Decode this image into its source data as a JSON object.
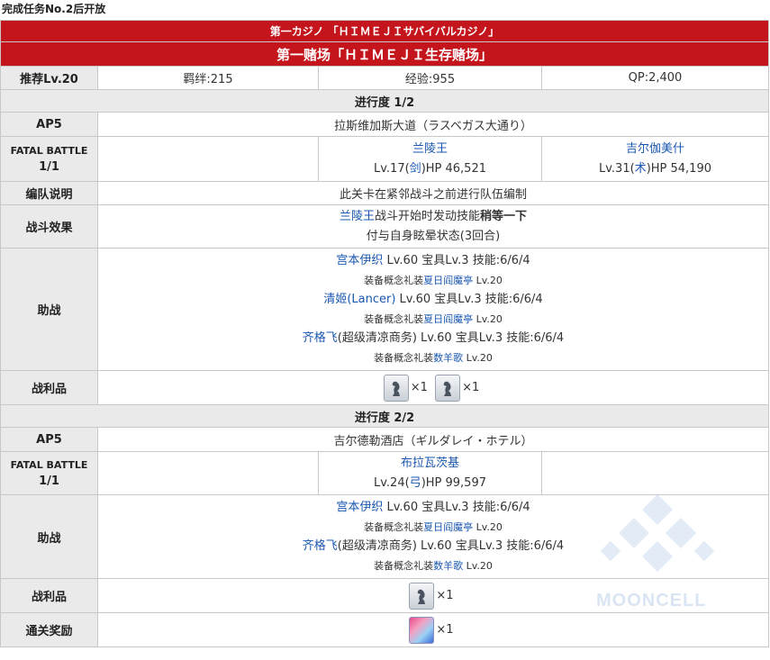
{
  "caption": "完成任务No.2后开放",
  "header": {
    "title_jp": "第一カジノ 「ＨＩＭＥＪＩサバイバルカジノ」",
    "title_cn": "第一赌场「ＨＩＭＥＪＩ生存赌场」"
  },
  "summary": {
    "recommend_label": "推荐Lv.20",
    "bond": "羁绊:215",
    "exp": "经验:955",
    "qp": "QP:2,400"
  },
  "stage1": {
    "progress": "进行度 1/2",
    "ap_label": "AP5",
    "location": "拉斯维加斯大道（ラスベガス大通り）",
    "battle_label_1": "FATAL BATTLE",
    "battle_label_2": "1/1",
    "enemies": [
      {
        "name": "兰陵王",
        "level": "Lv.17(",
        "cls": "剑",
        "hp": ")HP 46,521"
      },
      {
        "name": "吉尔伽美什",
        "level": "Lv.31(",
        "cls": "术",
        "hp": ")HP 54,190"
      }
    ],
    "formation_label": "编队说明",
    "formation_text": "此关卡在紧邻战斗之前进行队伍编制",
    "effect_label": "战斗效果",
    "effect_name": "兰陵王",
    "effect_line1_rest": "战斗开始时发动技能",
    "effect_line1_bold": "稍等一下",
    "effect_line2": "付与自身眩晕状态(3回合)",
    "support_label": "助战",
    "supports": [
      {
        "name": "宫本伊织",
        "stats": " Lv.60 宝具Lv.3 技能:6/6/4",
        "ce_prefix": "装备概念礼装",
        "ce_name": "夏日阎魔亭",
        "ce_lv": " Lv.20"
      },
      {
        "name": "清姬(Lancer)",
        "stats": " Lv.60 宝具Lv.3 技能:6/6/4",
        "ce_prefix": "装备概念礼装",
        "ce_name": "夏日阎魔亭",
        "ce_lv": " Lv.20"
      },
      {
        "name": "齐格飞",
        "stats": "(超级清凉商务) Lv.60 宝具Lv.3 技能:6/6/4",
        "ce_prefix": "装备概念礼装",
        "ce_name": "数羊歌",
        "ce_lv": " Lv.20"
      }
    ],
    "loot_label": "战利品",
    "loot": [
      {
        "icon": "chess-piece-icon",
        "mult": "×1"
      },
      {
        "icon": "chess-piece-icon",
        "mult": "×1"
      }
    ]
  },
  "stage2": {
    "progress": "进行度 2/2",
    "ap_label": "AP5",
    "location": "吉尔德勒酒店（ギルダレイ・ホテル）",
    "battle_label_1": "FATAL BATTLE",
    "battle_label_2": "1/1",
    "enemies": [
      {
        "name": "布拉瓦茨基",
        "level": "Lv.24(",
        "cls": "弓",
        "hp": ")HP 99,597"
      }
    ],
    "support_label": "助战",
    "supports": [
      {
        "name": "宫本伊织",
        "stats": " Lv.60 宝具Lv.3 技能:6/6/4",
        "ce_prefix": "装备概念礼装",
        "ce_name": "夏日阎魔亭",
        "ce_lv": " Lv.20"
      },
      {
        "name": "齐格飞",
        "stats": "(超级清凉商务) Lv.60 宝具Lv.3 技能:6/6/4",
        "ce_prefix": "装备概念礼装",
        "ce_name": "数羊歌",
        "ce_lv": " Lv.20"
      }
    ],
    "loot_label": "战利品",
    "loot": [
      {
        "icon": "chess-piece-icon",
        "mult": "×1"
      }
    ],
    "reward_label": "通关奖励",
    "reward": {
      "icon": "craft-essence-card-icon",
      "mult": "×1"
    }
  },
  "watermark": "MOONCELL",
  "colors": {
    "header_red": "#c4151c",
    "link_blue": "#1a57b0",
    "label_gray": "#eaeaea"
  }
}
